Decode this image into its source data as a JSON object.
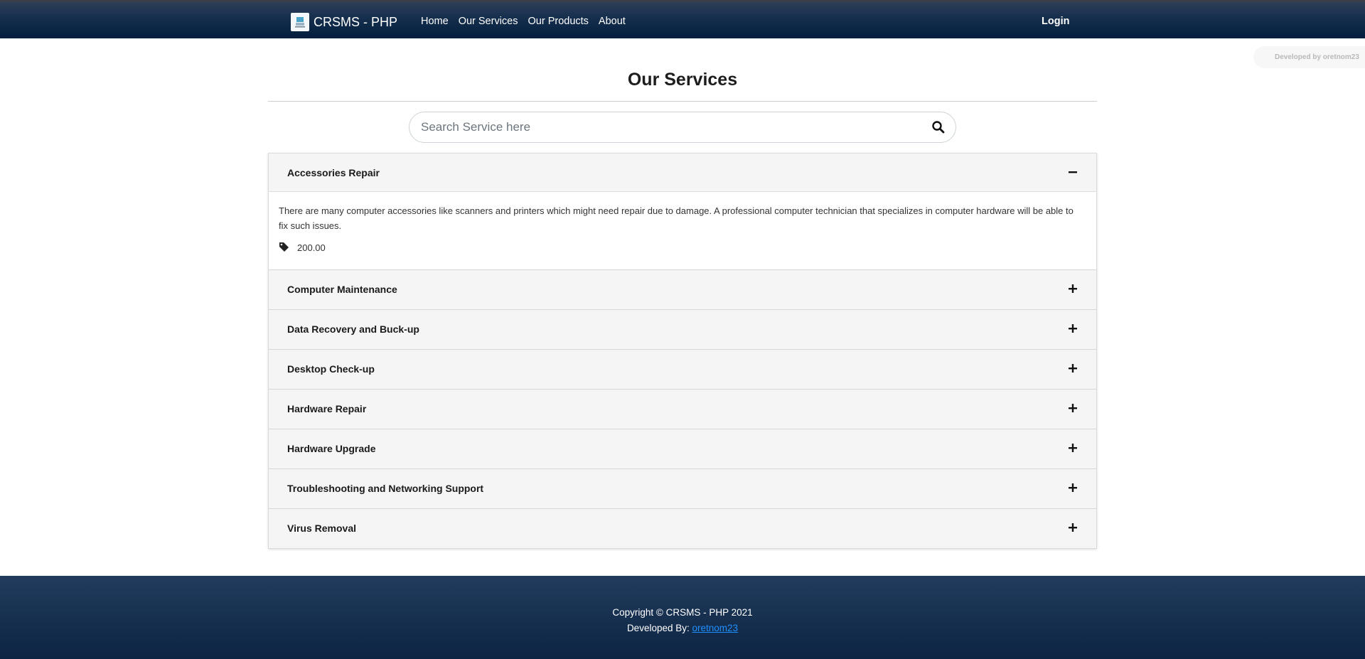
{
  "navbar": {
    "brand": "CRSMS - PHP",
    "links": [
      "Home",
      "Our Services",
      "Our Products",
      "About"
    ],
    "login": "Login"
  },
  "dev_badge": "Developed by oretnom23",
  "page": {
    "title": "Our Services"
  },
  "search": {
    "placeholder": "Search Service here",
    "value": ""
  },
  "services": [
    {
      "name": "Accessories Repair",
      "expanded": true,
      "description": "There are many computer accessories like scanners and printers which might need repair due to damage. A professional computer technician that specializes in computer hardware will be able to fix such issues.",
      "price": "200.00"
    },
    {
      "name": "Computer Maintenance",
      "expanded": false
    },
    {
      "name": "Data Recovery and Buck-up",
      "expanded": false
    },
    {
      "name": "Desktop Check-up",
      "expanded": false
    },
    {
      "name": "Hardware Repair",
      "expanded": false
    },
    {
      "name": "Hardware Upgrade",
      "expanded": false
    },
    {
      "name": "Troubleshooting and Networking Support",
      "expanded": false
    },
    {
      "name": "Virus Removal",
      "expanded": false
    }
  ],
  "footer": {
    "copyright": "Copyright © CRSMS - PHP 2021",
    "developed_by_label": "Developed By: ",
    "developer_link": "oretnom23"
  },
  "colors": {
    "navbar": "#021d3d",
    "footer": "#132d4f",
    "accordion_header": "#f5f5f5",
    "footer_link": "#1e90ff"
  }
}
